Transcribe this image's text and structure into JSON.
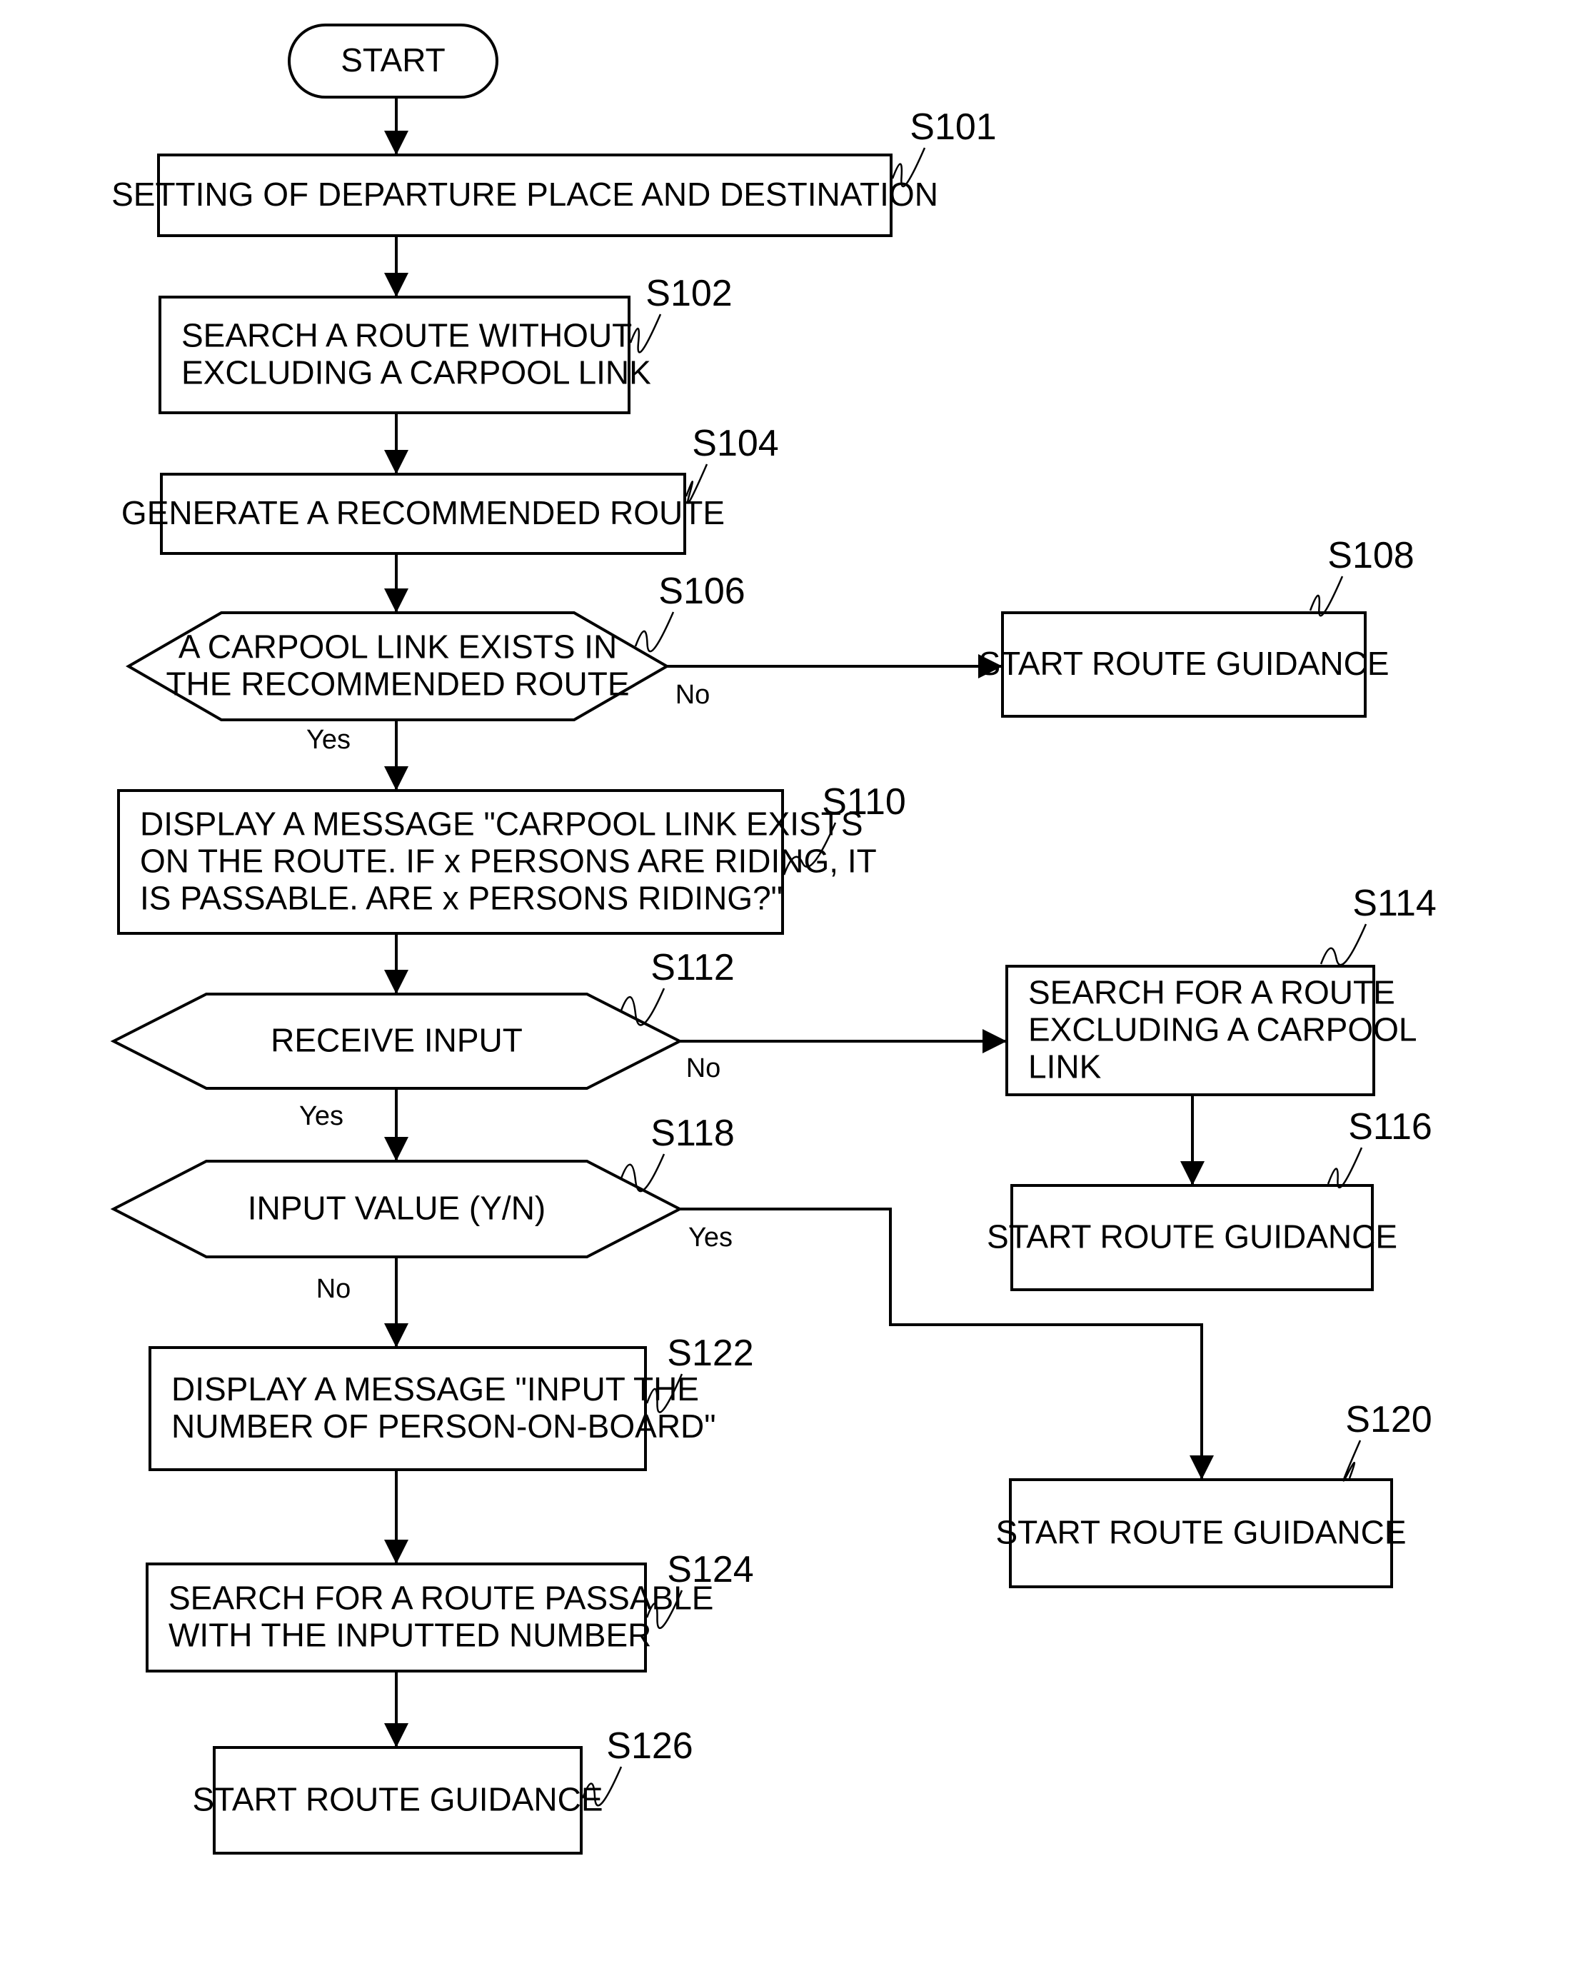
{
  "diagram": {
    "type": "flowchart",
    "nodes": [
      {
        "id": "start",
        "shape": "terminal",
        "label": "",
        "lines": [
          "START"
        ]
      },
      {
        "id": "S101",
        "shape": "process",
        "label": "S101",
        "lines": [
          "SETTING OF DEPARTURE PLACE AND DESTINATION"
        ]
      },
      {
        "id": "S102",
        "shape": "process",
        "label": "S102",
        "lines": [
          "SEARCH A ROUTE WITHOUT",
          "EXCLUDING A CARPOOL LINK"
        ]
      },
      {
        "id": "S104",
        "shape": "process",
        "label": "S104",
        "lines": [
          "GENERATE A RECOMMENDED ROUTE"
        ]
      },
      {
        "id": "S106",
        "shape": "decision",
        "label": "S106",
        "lines": [
          "A CARPOOL LINK EXISTS IN",
          "THE RECOMMENDED ROUTE"
        ]
      },
      {
        "id": "S108",
        "shape": "process",
        "label": "S108",
        "lines": [
          "START ROUTE GUIDANCE"
        ]
      },
      {
        "id": "S110",
        "shape": "process",
        "label": "S110",
        "lines": [
          "DISPLAY A MESSAGE \"CARPOOL LINK EXISTS",
          "ON THE ROUTE.  IF x PERSONS ARE RIDING, IT",
          "IS PASSABLE.  ARE x PERSONS RIDING?\""
        ]
      },
      {
        "id": "S112",
        "shape": "decision",
        "label": "S112",
        "lines": [
          "RECEIVE INPUT"
        ]
      },
      {
        "id": "S114",
        "shape": "process",
        "label": "S114",
        "lines": [
          "SEARCH FOR A ROUTE",
          "EXCLUDING A CARPOOL",
          "LINK"
        ]
      },
      {
        "id": "S116",
        "shape": "process",
        "label": "S116",
        "lines": [
          "START ROUTE GUIDANCE"
        ]
      },
      {
        "id": "S118",
        "shape": "decision",
        "label": "S118",
        "lines": [
          "INPUT VALUE (Y/N)"
        ]
      },
      {
        "id": "S120",
        "shape": "process",
        "label": "S120",
        "lines": [
          "START ROUTE GUIDANCE"
        ]
      },
      {
        "id": "S122",
        "shape": "process",
        "label": "S122",
        "lines": [
          "DISPLAY A MESSAGE \"INPUT THE",
          "NUMBER OF PERSON-ON-BOARD\""
        ]
      },
      {
        "id": "S124",
        "shape": "process",
        "label": "S124",
        "lines": [
          "SEARCH FOR A ROUTE PASSABLE",
          "WITH THE INPUTTED NUMBER"
        ]
      },
      {
        "id": "S126",
        "shape": "process",
        "label": "S126",
        "lines": [
          "START ROUTE GUIDANCE"
        ]
      }
    ],
    "edges": [
      {
        "from": "start",
        "to": "S101",
        "label": ""
      },
      {
        "from": "S101",
        "to": "S102",
        "label": ""
      },
      {
        "from": "S102",
        "to": "S104",
        "label": ""
      },
      {
        "from": "S104",
        "to": "S106",
        "label": ""
      },
      {
        "from": "S106",
        "to": "S108",
        "label": "No"
      },
      {
        "from": "S106",
        "to": "S110",
        "label": "Yes"
      },
      {
        "from": "S110",
        "to": "S112",
        "label": ""
      },
      {
        "from": "S112",
        "to": "S114",
        "label": "No"
      },
      {
        "from": "S114",
        "to": "S116",
        "label": ""
      },
      {
        "from": "S112",
        "to": "S118",
        "label": "Yes"
      },
      {
        "from": "S118",
        "to": "S120",
        "label": "Yes"
      },
      {
        "from": "S118",
        "to": "S122",
        "label": "No"
      },
      {
        "from": "S122",
        "to": "S124",
        "label": ""
      },
      {
        "from": "S124",
        "to": "S126",
        "label": ""
      }
    ]
  }
}
